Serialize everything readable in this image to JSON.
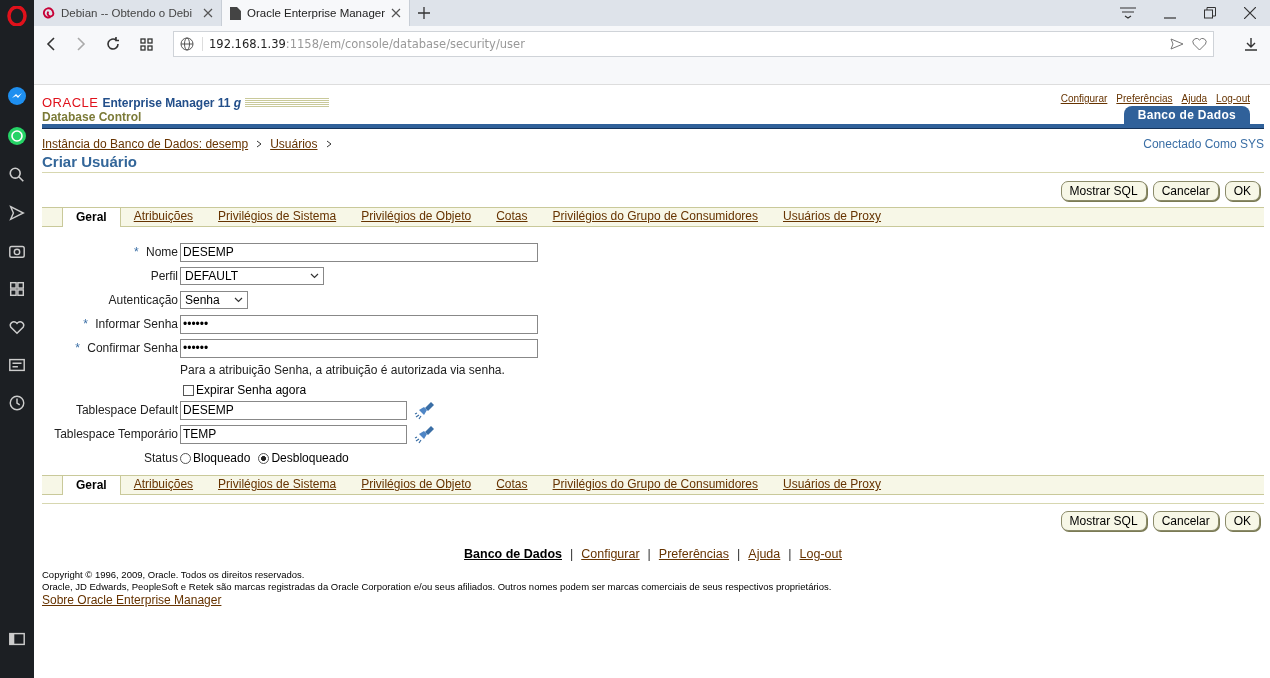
{
  "browser": {
    "tabs": [
      {
        "title": "Debian -- Obtendo o Debi",
        "selected": false,
        "kind": "debian"
      },
      {
        "title": "Oracle Enterprise Manager",
        "selected": true,
        "kind": "page"
      }
    ],
    "url_host": "192.168.1.39",
    "url_path": ":1158/em/console/database/security/user"
  },
  "header": {
    "logo": "ORACLE",
    "product": "Enterprise Manager 11 *g*",
    "subtitle": "Database Control",
    "global_links": [
      "Configurar",
      "Preferências",
      "Ajuda",
      "Log-out"
    ],
    "target_tab": "Banco de Dados"
  },
  "breadcrumbs": [
    "Instância do Banco de Dados: desemp",
    "Usuários"
  ],
  "connected_as": "Conectado Como SYS",
  "page_title": "Criar Usuário",
  "buttons_top": [
    "Mostrar SQL",
    "Cancelar",
    "OK"
  ],
  "tabs_top": [
    {
      "label": "Geral",
      "selected": true
    },
    {
      "label": "Atribuições",
      "selected": false
    },
    {
      "label": "Privilégios de Sistema",
      "selected": false
    },
    {
      "label": "Privilégios de Objeto",
      "selected": false
    },
    {
      "label": "Cotas",
      "selected": false
    },
    {
      "label": "Privilégios do Grupo de Consumidores",
      "selected": false
    },
    {
      "label": "Usuários de Proxy",
      "selected": false
    }
  ],
  "form": [
    {
      "kind": "text",
      "label": "Nome",
      "required_mark": "*",
      "value": "DESEMP"
    },
    {
      "kind": "select",
      "label": "Perfil",
      "value": "DEFAULT"
    },
    {
      "kind": "select",
      "label": "Autenticação",
      "value": "Senha"
    },
    {
      "kind": "password",
      "label": "Informar Senha",
      "required_mark": "*",
      "value": "••••••"
    },
    {
      "kind": "password",
      "label": "Confirmar Senha",
      "required_mark": "*",
      "value": "••••••"
    },
    {
      "kind": "note",
      "text": "Para a atribuição Senha, a atribuição é autorizada via senha."
    },
    {
      "kind": "checkbox",
      "text": "Expirar Senha agora",
      "checked": false
    },
    {
      "kind": "lookup",
      "label": "Tablespace Default",
      "value": "DESEMP"
    },
    {
      "kind": "lookup",
      "label": "Tablespace Temporário",
      "value": "TEMP"
    },
    {
      "kind": "radio",
      "label": "Status",
      "options": [
        {
          "label": "Bloqueado",
          "selected": false
        },
        {
          "label": "Desbloqueado",
          "selected": true
        }
      ]
    }
  ],
  "tabs_bottom": [
    {
      "label": "Geral",
      "selected": true
    },
    {
      "label": "Atribuições",
      "selected": false
    },
    {
      "label": "Privilégios de Sistema",
      "selected": false
    },
    {
      "label": "Privilégios de Objeto",
      "selected": false
    },
    {
      "label": "Cotas",
      "selected": false
    },
    {
      "label": "Privilégios do Grupo de Consumidores",
      "selected": false
    },
    {
      "label": "Usuários de Proxy",
      "selected": false
    }
  ],
  "buttons_bottom": [
    "Mostrar SQL",
    "Cancelar",
    "OK"
  ],
  "footer": {
    "links": [
      {
        "label": "Banco de Dados",
        "selected": true
      },
      {
        "separator": "|",
        "label": "Configurar",
        "selected": false
      },
      {
        "separator": "|",
        "label": "Preferências",
        "selected": false
      },
      {
        "separator": "|",
        "label": "Ajuda",
        "selected": false
      },
      {
        "separator": "|",
        "label": "Log-out",
        "selected": false
      }
    ],
    "copyright": "Copyright © 1996, 2009, Oracle. Todos os direitos reservados.",
    "trademark": "Oracle, JD Edwards, PeopleSoft e Retek são marcas registradas da Oracle Corporation e/ou seus afiliados. Outros nomes podem ser marcas comerciais de seus respectivos proprietários.",
    "about_link": "Sobre Oracle Enterprise Manager"
  }
}
